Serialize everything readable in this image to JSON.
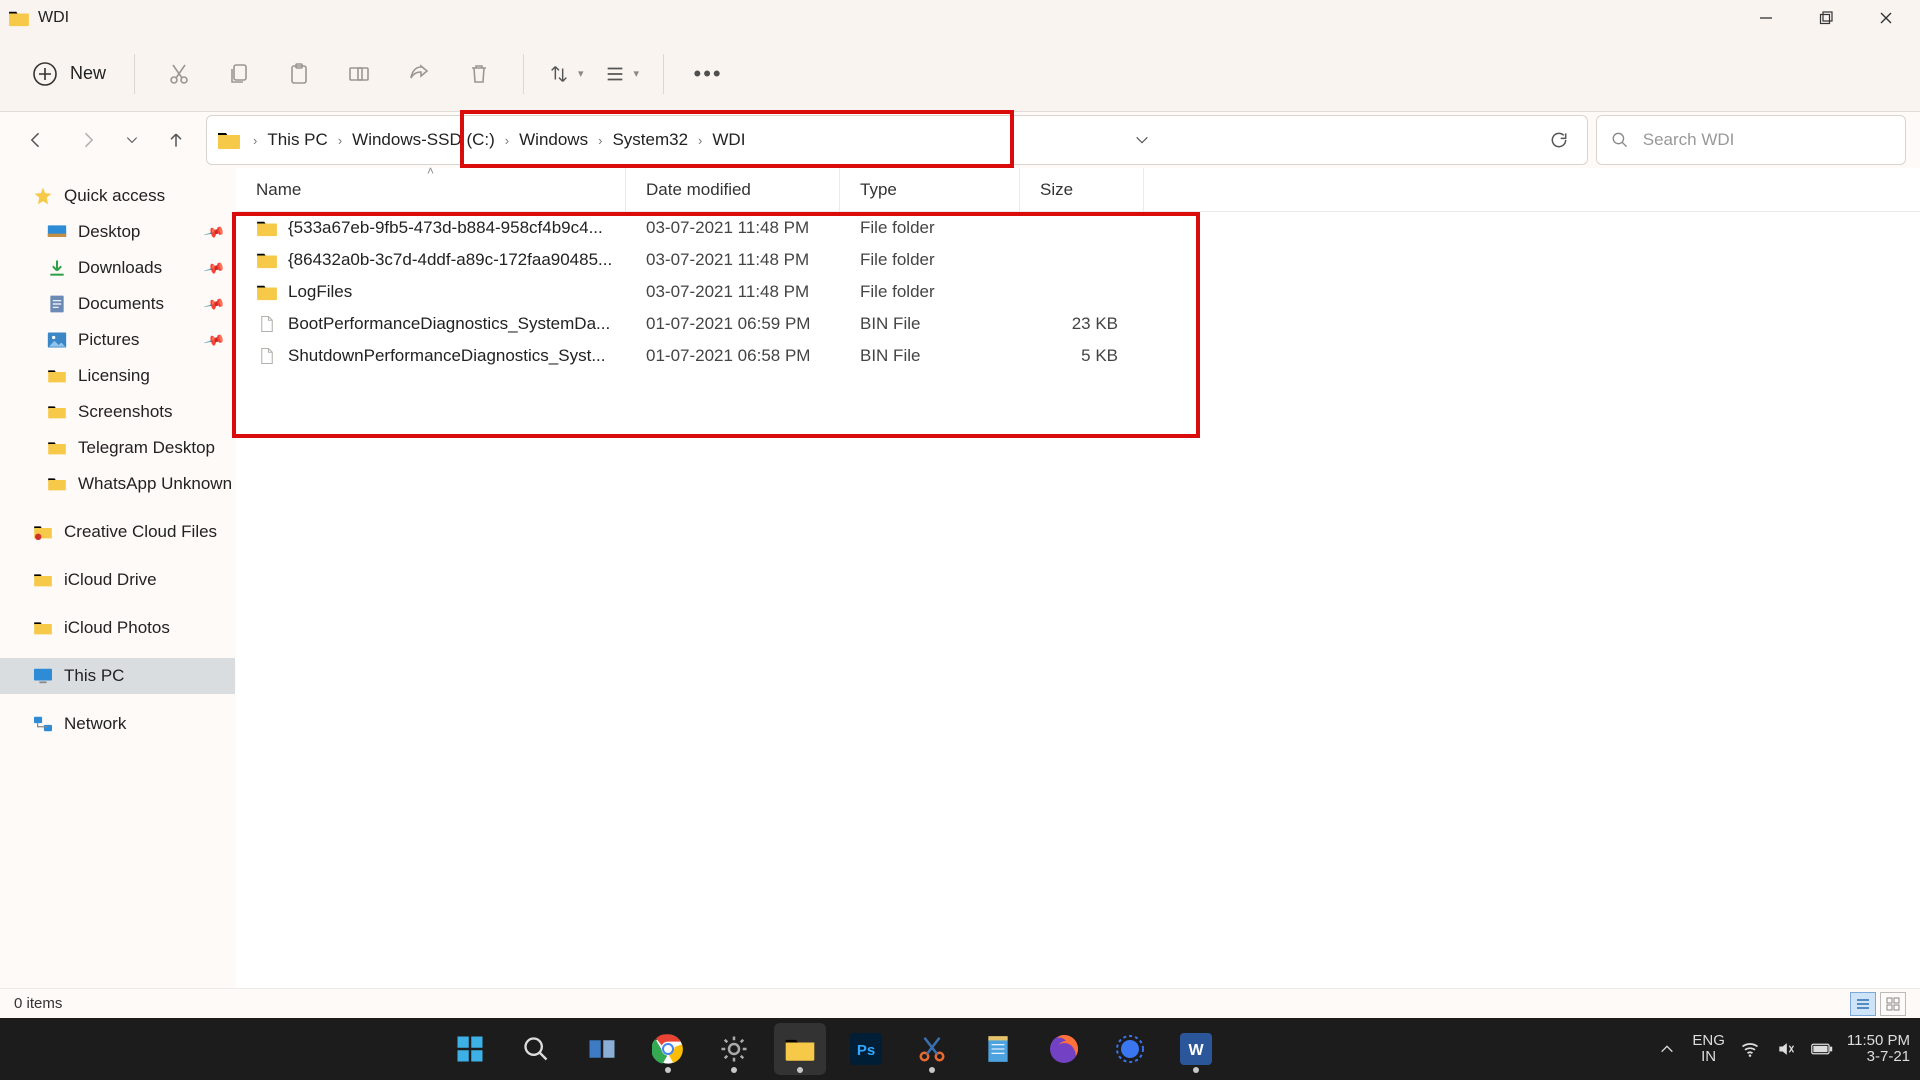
{
  "title": "WDI",
  "toolbar": {
    "new_label": "New"
  },
  "breadcrumbs": [
    "This PC",
    "Windows-SSD (C:)",
    "Windows",
    "System32",
    "WDI"
  ],
  "search": {
    "placeholder": "Search WDI"
  },
  "columns": {
    "name": "Name",
    "date": "Date modified",
    "type": "Type",
    "size": "Size"
  },
  "rows": [
    {
      "icon": "folder",
      "name": "{533a67eb-9fb5-473d-b884-958cf4b9c4...",
      "date": "03-07-2021 11:48 PM",
      "type": "File folder",
      "size": ""
    },
    {
      "icon": "folder",
      "name": "{86432a0b-3c7d-4ddf-a89c-172faa90485...",
      "date": "03-07-2021 11:48 PM",
      "type": "File folder",
      "size": ""
    },
    {
      "icon": "folder",
      "name": "LogFiles",
      "date": "03-07-2021 11:48 PM",
      "type": "File folder",
      "size": ""
    },
    {
      "icon": "file",
      "name": "BootPerformanceDiagnostics_SystemDa...",
      "date": "01-07-2021 06:59 PM",
      "type": "BIN File",
      "size": "23 KB"
    },
    {
      "icon": "file",
      "name": "ShutdownPerformanceDiagnostics_Syst...",
      "date": "01-07-2021 06:58 PM",
      "type": "BIN File",
      "size": "5 KB"
    }
  ],
  "sidebar": {
    "quick_access": "Quick access",
    "pinned": [
      "Desktop",
      "Downloads",
      "Documents",
      "Pictures"
    ],
    "recent": [
      "Licensing",
      "Screenshots",
      "Telegram Desktop",
      "WhatsApp Unknown"
    ],
    "cloud": [
      "Creative Cloud Files",
      "iCloud Drive",
      "iCloud Photos"
    ],
    "this_pc": "This PC",
    "network": "Network"
  },
  "status": {
    "items": "0 items"
  },
  "tray": {
    "lang1": "ENG",
    "lang2": "IN",
    "time": "11:50 PM",
    "date": "3-7-21"
  }
}
